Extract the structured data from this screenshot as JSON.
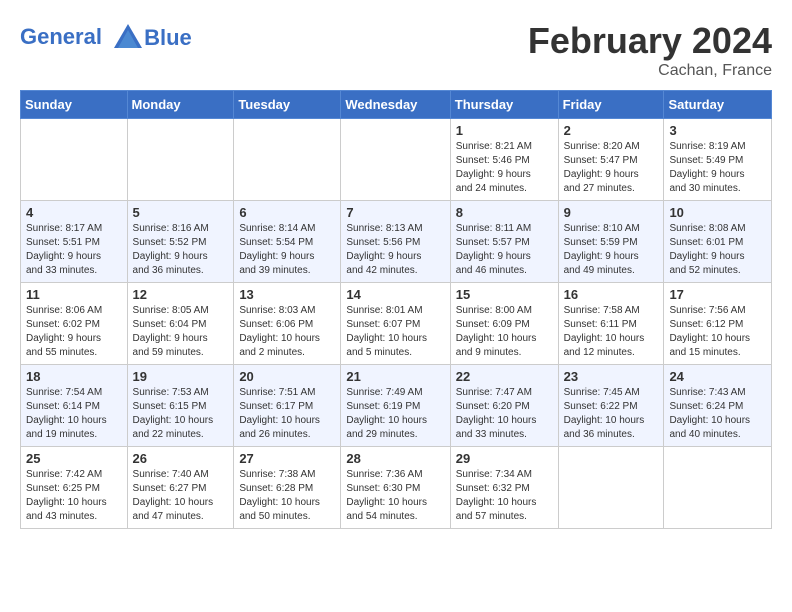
{
  "header": {
    "logo_line1": "General",
    "logo_line2": "Blue",
    "month_year": "February 2024",
    "location": "Cachan, France"
  },
  "weekdays": [
    "Sunday",
    "Monday",
    "Tuesday",
    "Wednesday",
    "Thursday",
    "Friday",
    "Saturday"
  ],
  "weeks": [
    [
      {
        "day": "",
        "info": ""
      },
      {
        "day": "",
        "info": ""
      },
      {
        "day": "",
        "info": ""
      },
      {
        "day": "",
        "info": ""
      },
      {
        "day": "1",
        "info": "Sunrise: 8:21 AM\nSunset: 5:46 PM\nDaylight: 9 hours\nand 24 minutes."
      },
      {
        "day": "2",
        "info": "Sunrise: 8:20 AM\nSunset: 5:47 PM\nDaylight: 9 hours\nand 27 minutes."
      },
      {
        "day": "3",
        "info": "Sunrise: 8:19 AM\nSunset: 5:49 PM\nDaylight: 9 hours\nand 30 minutes."
      }
    ],
    [
      {
        "day": "4",
        "info": "Sunrise: 8:17 AM\nSunset: 5:51 PM\nDaylight: 9 hours\nand 33 minutes."
      },
      {
        "day": "5",
        "info": "Sunrise: 8:16 AM\nSunset: 5:52 PM\nDaylight: 9 hours\nand 36 minutes."
      },
      {
        "day": "6",
        "info": "Sunrise: 8:14 AM\nSunset: 5:54 PM\nDaylight: 9 hours\nand 39 minutes."
      },
      {
        "day": "7",
        "info": "Sunrise: 8:13 AM\nSunset: 5:56 PM\nDaylight: 9 hours\nand 42 minutes."
      },
      {
        "day": "8",
        "info": "Sunrise: 8:11 AM\nSunset: 5:57 PM\nDaylight: 9 hours\nand 46 minutes."
      },
      {
        "day": "9",
        "info": "Sunrise: 8:10 AM\nSunset: 5:59 PM\nDaylight: 9 hours\nand 49 minutes."
      },
      {
        "day": "10",
        "info": "Sunrise: 8:08 AM\nSunset: 6:01 PM\nDaylight: 9 hours\nand 52 minutes."
      }
    ],
    [
      {
        "day": "11",
        "info": "Sunrise: 8:06 AM\nSunset: 6:02 PM\nDaylight: 9 hours\nand 55 minutes."
      },
      {
        "day": "12",
        "info": "Sunrise: 8:05 AM\nSunset: 6:04 PM\nDaylight: 9 hours\nand 59 minutes."
      },
      {
        "day": "13",
        "info": "Sunrise: 8:03 AM\nSunset: 6:06 PM\nDaylight: 10 hours\nand 2 minutes."
      },
      {
        "day": "14",
        "info": "Sunrise: 8:01 AM\nSunset: 6:07 PM\nDaylight: 10 hours\nand 5 minutes."
      },
      {
        "day": "15",
        "info": "Sunrise: 8:00 AM\nSunset: 6:09 PM\nDaylight: 10 hours\nand 9 minutes."
      },
      {
        "day": "16",
        "info": "Sunrise: 7:58 AM\nSunset: 6:11 PM\nDaylight: 10 hours\nand 12 minutes."
      },
      {
        "day": "17",
        "info": "Sunrise: 7:56 AM\nSunset: 6:12 PM\nDaylight: 10 hours\nand 15 minutes."
      }
    ],
    [
      {
        "day": "18",
        "info": "Sunrise: 7:54 AM\nSunset: 6:14 PM\nDaylight: 10 hours\nand 19 minutes."
      },
      {
        "day": "19",
        "info": "Sunrise: 7:53 AM\nSunset: 6:15 PM\nDaylight: 10 hours\nand 22 minutes."
      },
      {
        "day": "20",
        "info": "Sunrise: 7:51 AM\nSunset: 6:17 PM\nDaylight: 10 hours\nand 26 minutes."
      },
      {
        "day": "21",
        "info": "Sunrise: 7:49 AM\nSunset: 6:19 PM\nDaylight: 10 hours\nand 29 minutes."
      },
      {
        "day": "22",
        "info": "Sunrise: 7:47 AM\nSunset: 6:20 PM\nDaylight: 10 hours\nand 33 minutes."
      },
      {
        "day": "23",
        "info": "Sunrise: 7:45 AM\nSunset: 6:22 PM\nDaylight: 10 hours\nand 36 minutes."
      },
      {
        "day": "24",
        "info": "Sunrise: 7:43 AM\nSunset: 6:24 PM\nDaylight: 10 hours\nand 40 minutes."
      }
    ],
    [
      {
        "day": "25",
        "info": "Sunrise: 7:42 AM\nSunset: 6:25 PM\nDaylight: 10 hours\nand 43 minutes."
      },
      {
        "day": "26",
        "info": "Sunrise: 7:40 AM\nSunset: 6:27 PM\nDaylight: 10 hours\nand 47 minutes."
      },
      {
        "day": "27",
        "info": "Sunrise: 7:38 AM\nSunset: 6:28 PM\nDaylight: 10 hours\nand 50 minutes."
      },
      {
        "day": "28",
        "info": "Sunrise: 7:36 AM\nSunset: 6:30 PM\nDaylight: 10 hours\nand 54 minutes."
      },
      {
        "day": "29",
        "info": "Sunrise: 7:34 AM\nSunset: 6:32 PM\nDaylight: 10 hours\nand 57 minutes."
      },
      {
        "day": "",
        "info": ""
      },
      {
        "day": "",
        "info": ""
      }
    ]
  ]
}
